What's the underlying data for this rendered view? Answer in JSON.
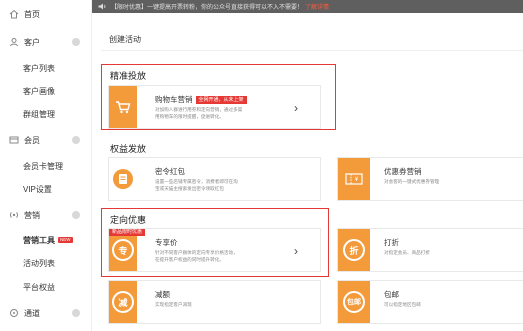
{
  "sidebar": {
    "items": [
      {
        "label": "首页",
        "icon": "home-icon"
      },
      {
        "label": "客户",
        "icon": "user-icon"
      },
      {
        "label": "客户列表"
      },
      {
        "label": "客户画像"
      },
      {
        "label": "群组管理"
      },
      {
        "label": "会员",
        "icon": "card-icon"
      },
      {
        "label": "会员卡管理"
      },
      {
        "label": "VIP设置"
      },
      {
        "label": "营销",
        "icon": "broadcast-icon"
      },
      {
        "label": "营销工具",
        "badge": "NEW"
      },
      {
        "label": "活动列表"
      },
      {
        "label": "平台权益"
      },
      {
        "label": "通道",
        "icon": "channel-icon"
      }
    ]
  },
  "notice": {
    "text": "【限时优惠】一键提高开票转粉，你的公众号直接获得可以不入不需要！",
    "link": "了解详情"
  },
  "page": {
    "title": "创建活动"
  },
  "sections": {
    "precise": "精准投放",
    "rights": "权益发放",
    "targeted": "定向优惠"
  },
  "cards": {
    "cart": {
      "title": "购物车营销",
      "tag": "全网开通，从未上架",
      "desc": "对加购人群进行用券和定向营销，通过多渠\n用购物车的限时提醒，促进转化。"
    },
    "redpacket": {
      "title": "密令红包",
      "desc": "设置一些店铺专属密令，消费者即可在淘\n宝或天猫主搜索发出密令领取红包"
    },
    "coupon": {
      "title": "优惠券营销",
      "desc": "对会客的一键式优惠券管理"
    },
    "exclusive": {
      "title": "专享价",
      "ribbon": "新品限时优惠",
      "desc": "针对不同客户群体的定向专享价格活动，\n在提升客户权益的同时提升转化。"
    },
    "discount": {
      "title": "打折",
      "desc": "对指定会员、商品打折"
    },
    "reduce": {
      "title": "减额",
      "desc": "实现指定客户减现"
    },
    "shipping": {
      "title": "包邮",
      "desc": "可以指定地区包邮"
    }
  },
  "colors": {
    "accent": "#e53935",
    "orange": "#f39a3b",
    "sidebar_dot": "#d8d8d8"
  }
}
